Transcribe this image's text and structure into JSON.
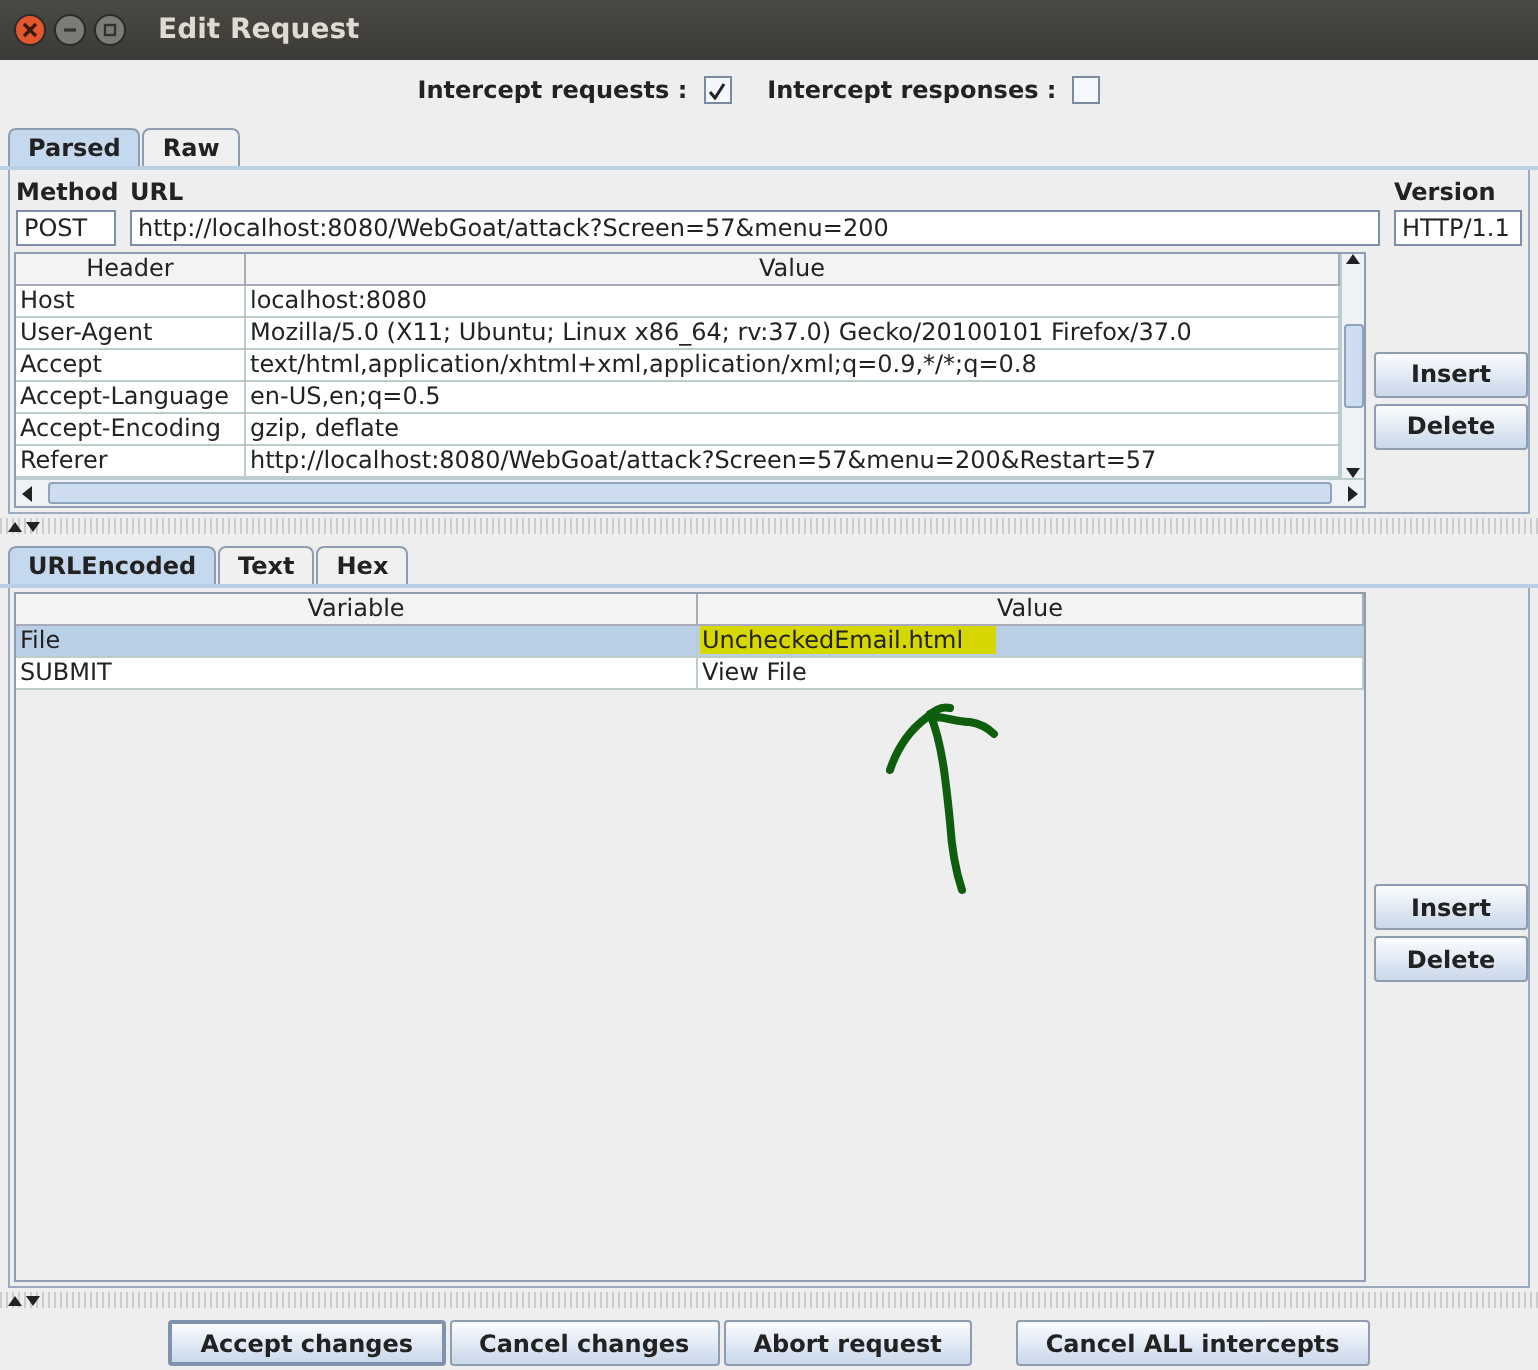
{
  "window": {
    "title": "Edit Request"
  },
  "intercept": [
    {
      "label": "Intercept requests :",
      "checked": true
    },
    {
      "label": "Intercept responses :",
      "checked": false
    }
  ],
  "top_tabs": [
    {
      "label": "Parsed",
      "selected": true
    },
    {
      "label": "Raw",
      "selected": false
    }
  ],
  "request_line": {
    "method_label": "Method",
    "method": "POST",
    "url_label": "URL",
    "url": "http://localhost:8080/WebGoat/attack?Screen=57&menu=200",
    "version_label": "Version",
    "version": "HTTP/1.1"
  },
  "headers_table": {
    "columns": [
      "Header",
      "Value"
    ],
    "rows": [
      {
        "cells": [
          "Host",
          "localhost:8080"
        ]
      },
      {
        "cells": [
          "User-Agent",
          "Mozilla/5.0 (X11; Ubuntu; Linux x86_64; rv:37.0) Gecko/20100101 Firefox/37.0"
        ]
      },
      {
        "cells": [
          "Accept",
          "text/html,application/xhtml+xml,application/xml;q=0.9,*/*;q=0.8"
        ]
      },
      {
        "cells": [
          "Accept-Language",
          "en-US,en;q=0.5"
        ]
      },
      {
        "cells": [
          "Accept-Encoding",
          "gzip, deflate"
        ]
      },
      {
        "cells": [
          "Referer",
          "http://localhost:8080/WebGoat/attack?Screen=57&menu=200&Restart=57"
        ]
      }
    ],
    "buttons": [
      "Insert",
      "Delete"
    ]
  },
  "body_tabs": [
    {
      "label": "URLEncoded",
      "selected": true
    },
    {
      "label": "Text",
      "selected": false
    },
    {
      "label": "Hex",
      "selected": false
    }
  ],
  "params_table": {
    "columns": [
      "Variable",
      "Value"
    ],
    "rows": [
      {
        "cells": [
          "File",
          "UncheckedEmail.html"
        ],
        "selected": true,
        "highlighted": true
      },
      {
        "cells": [
          "SUBMIT",
          "View File"
        ],
        "selected": false,
        "highlighted": false
      }
    ],
    "buttons": [
      "Insert",
      "Delete"
    ]
  },
  "footer_buttons": [
    {
      "label": "Accept changes",
      "selected": true
    },
    {
      "label": "Cancel changes",
      "selected": false
    },
    {
      "label": "Abort request",
      "selected": false
    },
    {
      "label": "Cancel ALL intercepts",
      "selected": false
    }
  ]
}
